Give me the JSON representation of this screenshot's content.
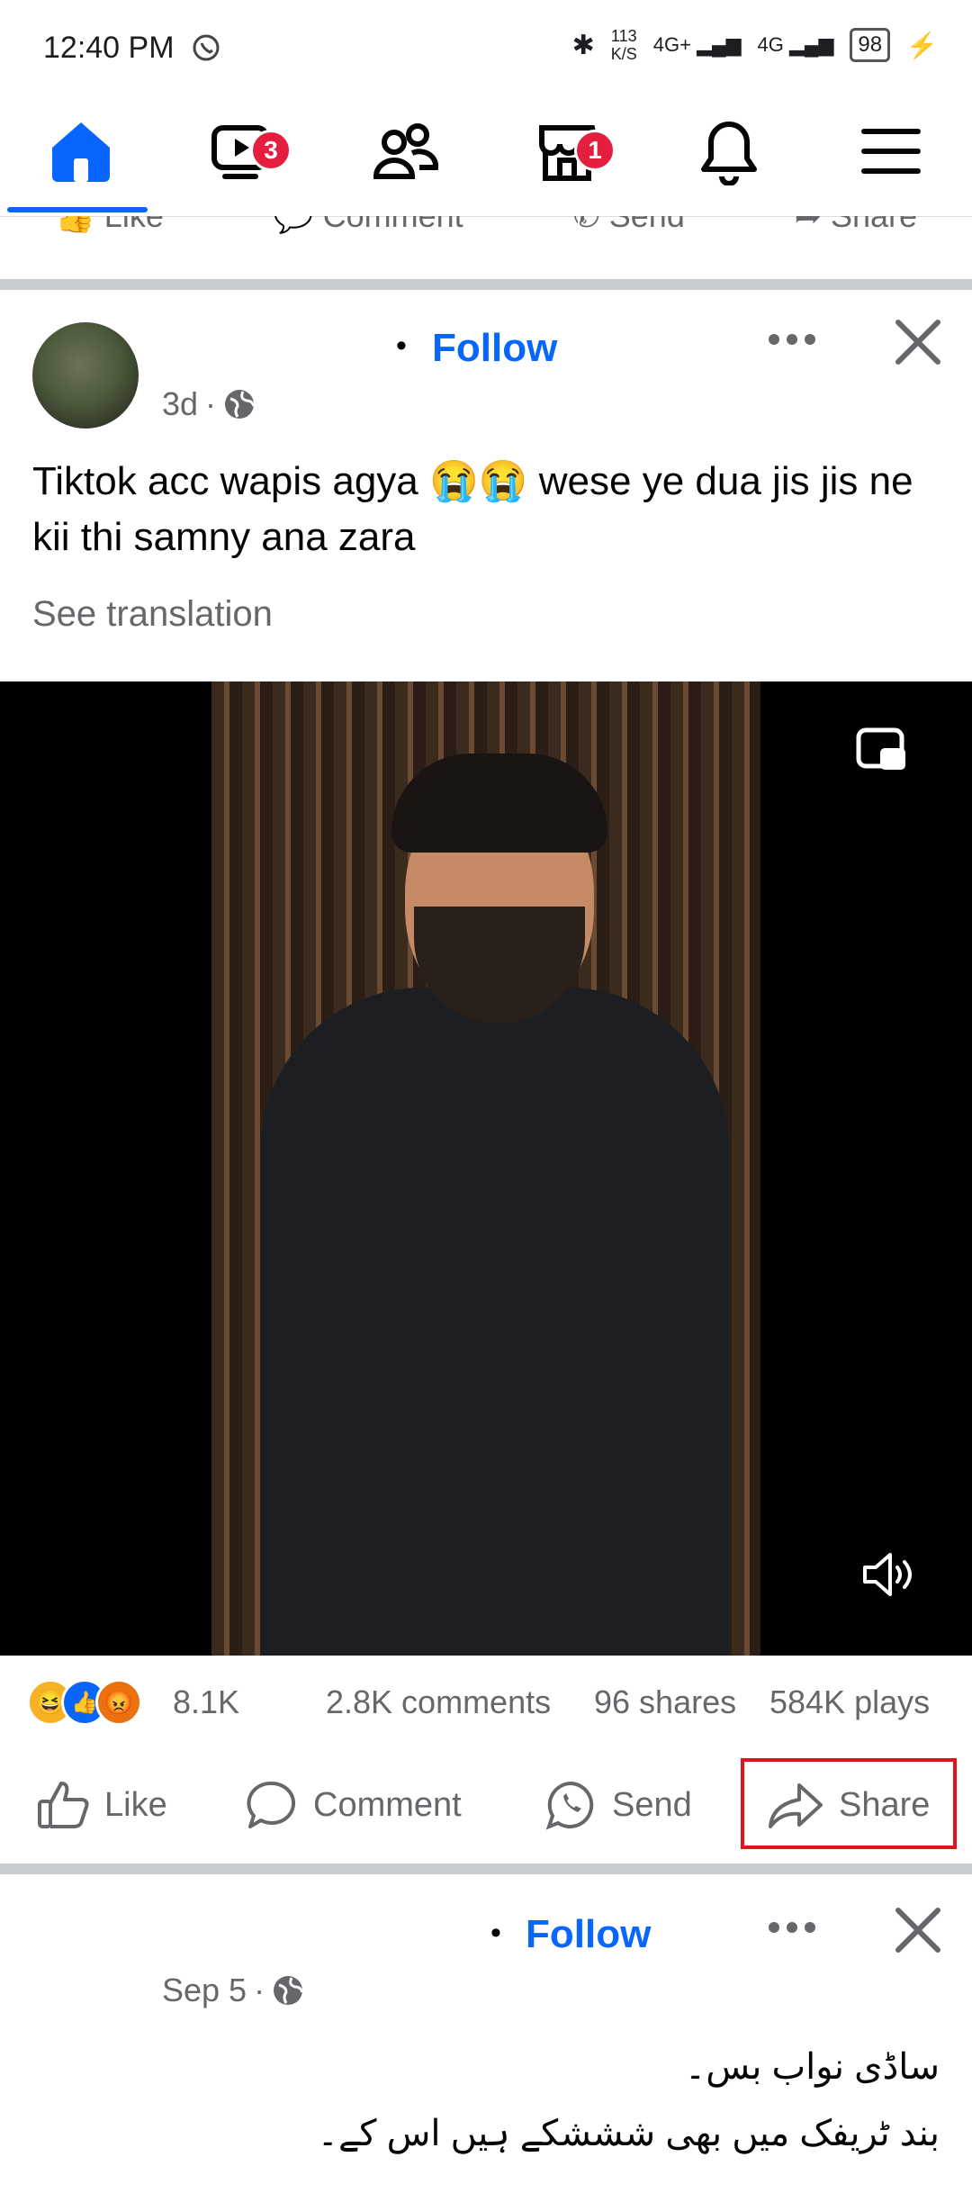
{
  "status_bar": {
    "time": "12:40 PM",
    "network_speed": "113 K/S",
    "network_speed_top": "113",
    "network_speed_bottom": "K/S",
    "signal_1": "4G+",
    "signal_2": "4G",
    "battery": "98"
  },
  "nav": {
    "items": [
      {
        "name": "home",
        "icon": "home-icon"
      },
      {
        "name": "video",
        "icon": "video-icon",
        "badge": "3"
      },
      {
        "name": "friends",
        "icon": "friends-icon"
      },
      {
        "name": "marketplace",
        "icon": "marketplace-icon",
        "badge": "1"
      },
      {
        "name": "notifications",
        "icon": "bell-icon"
      },
      {
        "name": "menu",
        "icon": "menu-icon"
      }
    ]
  },
  "previous_post_actions": {
    "like": "Like",
    "comment": "Comment",
    "send": "Send",
    "share": "Share"
  },
  "post1": {
    "follow": "Follow",
    "time": "3d",
    "text": "Tiktok acc wapis agya 😭😭 wese ye dua jis jis ne kii thi samny ana zara",
    "see_translation": "See translation",
    "reactions_count": "8.1K",
    "comments": "2.8K comments",
    "shares": "96 shares",
    "plays": "584K plays",
    "actions": {
      "like": "Like",
      "comment": "Comment",
      "send": "Send",
      "share": "Share"
    }
  },
  "post2": {
    "follow": "Follow",
    "time": "Sep 5",
    "line1": "ساڈی نواب بس۔",
    "line2": "بند ٹریفک میں بھی شششکے ہیں اس کے۔"
  },
  "colors": {
    "accent": "#0866ff",
    "badge": "#e41e3f",
    "highlight": "#e1141c",
    "muted": "#65676b"
  }
}
